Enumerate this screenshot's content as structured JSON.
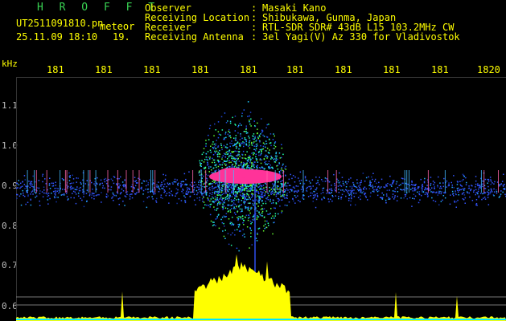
{
  "header": {
    "title": "H R O F F T",
    "filename": "UT2511091810.pn",
    "meteor_label": "meteor",
    "timestamp": "25.11.09 18:10",
    "count": "19."
  },
  "metadata": [
    {
      "label": "Observer",
      "value": "Masaki Kano"
    },
    {
      "label": "Receiving Location",
      "value": "Shibukawa, Gunma, Japan"
    },
    {
      "label": "Receiver",
      "value": "RTL-SDR SDR# 43dB L15 103.2MHz CW"
    },
    {
      "label": "Receiving Antenna",
      "value": "3el Yagi(V) Az 330 for Vladivostok"
    }
  ],
  "separator": ":",
  "axis": {
    "unit_label": "kHz",
    "freq_ticks": [
      "181",
      "181",
      "181",
      "181",
      "181",
      "181",
      "181",
      "181",
      "181",
      "1820"
    ],
    "y_ticks": [
      "1.1",
      "1.0",
      "0.9",
      "0.8",
      "0.7",
      "0.6"
    ]
  },
  "colors": {
    "header_title": "#39d353",
    "text": "#ffff00",
    "echo_core": "#ff3399",
    "noise": "#3355ff",
    "histogram": "#ffff00",
    "baseline": "#00e5ff"
  }
}
